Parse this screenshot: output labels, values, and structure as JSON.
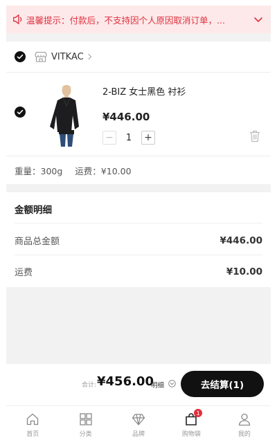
{
  "notice": {
    "text": "温馨提示：付款后，不支持因个人原因取消订单，..."
  },
  "store": {
    "name": "VITKAC"
  },
  "item": {
    "title": "2-BIZ 女士黑色 衬衫",
    "price": "¥446.00",
    "minus": "−",
    "qty": "1",
    "plus": "+"
  },
  "shipping_info": {
    "weight": "重量：300g",
    "freight": "运费：¥10.00"
  },
  "amount_detail": {
    "title": "金额明细",
    "rows": [
      {
        "label": "商品总金额",
        "value": "¥446.00"
      },
      {
        "label": "运费",
        "value": "¥10.00"
      }
    ]
  },
  "checkout": {
    "total_label": "合计:",
    "total_value": "¥456.00",
    "detail_label": "明细",
    "button_label": "去结算(1)"
  },
  "tabbar": {
    "items": [
      {
        "label": "首页",
        "icon": "home-icon"
      },
      {
        "label": "分类",
        "icon": "category-icon"
      },
      {
        "label": "品牌",
        "icon": "diamond-icon"
      },
      {
        "label": "购物袋",
        "icon": "bag-icon",
        "badge": "1"
      },
      {
        "label": "我的",
        "icon": "user-icon"
      }
    ]
  },
  "colors": {
    "accent": "#e0303e",
    "notice_bg": "#fde9ea",
    "primary": "#111111"
  }
}
